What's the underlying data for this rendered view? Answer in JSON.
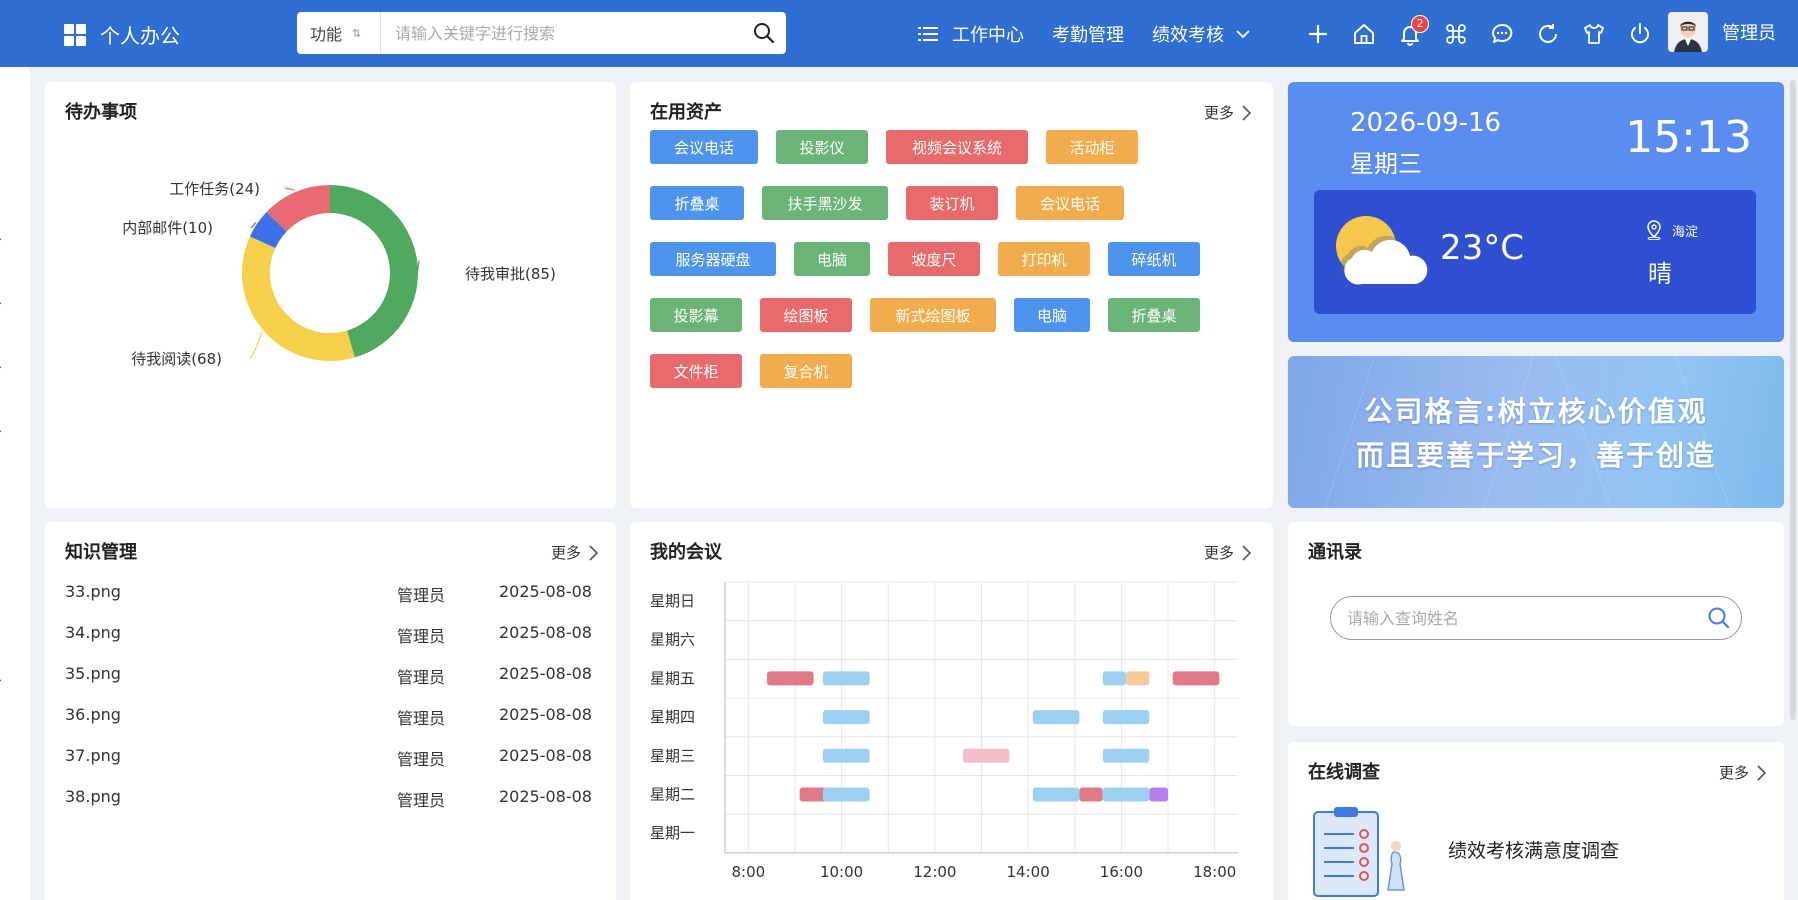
{
  "app": {
    "title": "个人办公"
  },
  "search": {
    "type_label": "功能",
    "sort_glyph": "⇅",
    "placeholder": "请输入关键字进行搜索"
  },
  "nav": {
    "items": [
      "工作中心",
      "考勤管理",
      "绩效考核"
    ],
    "notification_count": "2",
    "user_name": "管理员"
  },
  "todo": {
    "title": "待办事项",
    "segments": [
      {
        "label": "待我审批(85)",
        "value": 85,
        "color": "#4faa5f"
      },
      {
        "label": "待我阅读(68)",
        "value": 68,
        "color": "#f7d04b"
      },
      {
        "label": "内部邮件(10)",
        "value": 10,
        "color": "#3d6fe8"
      },
      {
        "label": "工作任务(24)",
        "value": 24,
        "color": "#ea6a74"
      }
    ]
  },
  "assets": {
    "title": "在用资产",
    "more": "更多",
    "tags": [
      {
        "label": "会议电话",
        "color": "#4d94ef"
      },
      {
        "label": "投影仪",
        "color": "#6ab477"
      },
      {
        "label": "视频会议系统",
        "color": "#e86a6a"
      },
      {
        "label": "活动柜",
        "color": "#f3ac4b"
      },
      {
        "label": "折叠桌",
        "color": "#4d94ef"
      },
      {
        "label": "扶手黑沙发",
        "color": "#6ab477"
      },
      {
        "label": "装订机",
        "color": "#e86a6a"
      },
      {
        "label": "会议电话",
        "color": "#f3ac4b"
      },
      {
        "label": "服务器硬盘",
        "color": "#4d94ef"
      },
      {
        "label": "电脑",
        "color": "#6ab477"
      },
      {
        "label": "坡度尺",
        "color": "#e86a6a"
      },
      {
        "label": "打印机",
        "color": "#f3ac4b"
      },
      {
        "label": "碎纸机",
        "color": "#4d94ef"
      },
      {
        "label": "投影幕",
        "color": "#6ab477"
      },
      {
        "label": "绘图板",
        "color": "#e86a6a"
      },
      {
        "label": "新式绘图板",
        "color": "#f3ac4b"
      },
      {
        "label": "电脑",
        "color": "#4d94ef"
      },
      {
        "label": "折叠桌",
        "color": "#6ab477"
      },
      {
        "label": "文件柜",
        "color": "#e86a6a"
      },
      {
        "label": "复合机",
        "color": "#f3ac4b"
      }
    ]
  },
  "weather": {
    "date": "2026-09-16",
    "weekday": "星期三",
    "time": "15:13",
    "temperature": "23°C",
    "location": "海淀",
    "condition": "晴"
  },
  "motto": {
    "line1": "公司格言:树立核心价值观",
    "line2": "而且要善于学习，善于创造"
  },
  "knowledge": {
    "title": "知识管理",
    "more": "更多",
    "rows": [
      {
        "name": "33.png",
        "owner": "管理员",
        "date": "2025-08-08"
      },
      {
        "name": "34.png",
        "owner": "管理员",
        "date": "2025-08-08"
      },
      {
        "name": "35.png",
        "owner": "管理员",
        "date": "2025-08-08"
      },
      {
        "name": "36.png",
        "owner": "管理员",
        "date": "2025-08-08"
      },
      {
        "name": "37.png",
        "owner": "管理员",
        "date": "2025-08-08"
      },
      {
        "name": "38.png",
        "owner": "管理员",
        "date": "2025-08-08"
      }
    ]
  },
  "meetings": {
    "title": "我的会议",
    "more": "更多"
  },
  "chart_data": {
    "type": "scatter",
    "days": [
      "星期日",
      "星期六",
      "星期五",
      "星期四",
      "星期三",
      "星期二",
      "星期一"
    ],
    "x_ticks": [
      "8:00",
      "10:00",
      "12:00",
      "14:00",
      "16:00",
      "18:00"
    ],
    "xlim": [
      7.5,
      18.5
    ],
    "meetings": [
      {
        "day": "星期五",
        "start": 8.4,
        "end": 9.4,
        "color": "#e07a86"
      },
      {
        "day": "星期五",
        "start": 9.6,
        "end": 10.6,
        "color": "#9cd0f0"
      },
      {
        "day": "星期五",
        "start": 15.6,
        "end": 16.1,
        "color": "#9cd0f0"
      },
      {
        "day": "星期五",
        "start": 16.1,
        "end": 16.6,
        "color": "#f5c99a"
      },
      {
        "day": "星期五",
        "start": 17.1,
        "end": 18.1,
        "color": "#e07a86"
      },
      {
        "day": "星期四",
        "start": 9.6,
        "end": 10.6,
        "color": "#9cd0f0"
      },
      {
        "day": "星期四",
        "start": 14.1,
        "end": 15.1,
        "color": "#9cd0f0"
      },
      {
        "day": "星期四",
        "start": 15.6,
        "end": 16.6,
        "color": "#9cd0f0"
      },
      {
        "day": "星期三",
        "start": 9.6,
        "end": 10.6,
        "color": "#9cd0f0"
      },
      {
        "day": "星期三",
        "start": 12.6,
        "end": 13.6,
        "color": "#f4bdc8"
      },
      {
        "day": "星期三",
        "start": 15.6,
        "end": 16.6,
        "color": "#9cd0f0"
      },
      {
        "day": "星期二",
        "start": 9.1,
        "end": 9.7,
        "color": "#e07a86"
      },
      {
        "day": "星期二",
        "start": 9.6,
        "end": 10.6,
        "color": "#9cd0f0"
      },
      {
        "day": "星期二",
        "start": 14.1,
        "end": 15.1,
        "color": "#9cd0f0"
      },
      {
        "day": "星期二",
        "start": 15.1,
        "end": 15.6,
        "color": "#e07a86"
      },
      {
        "day": "星期二",
        "start": 15.6,
        "end": 16.6,
        "color": "#9cd0f0"
      },
      {
        "day": "星期二",
        "start": 16.6,
        "end": 17.0,
        "color": "#b57ef0"
      }
    ]
  },
  "contacts": {
    "title": "通讯录",
    "placeholder": "请输入查询姓名"
  },
  "survey": {
    "title": "在线调查",
    "more": "更多",
    "item": "绩效考核满意度调查"
  }
}
